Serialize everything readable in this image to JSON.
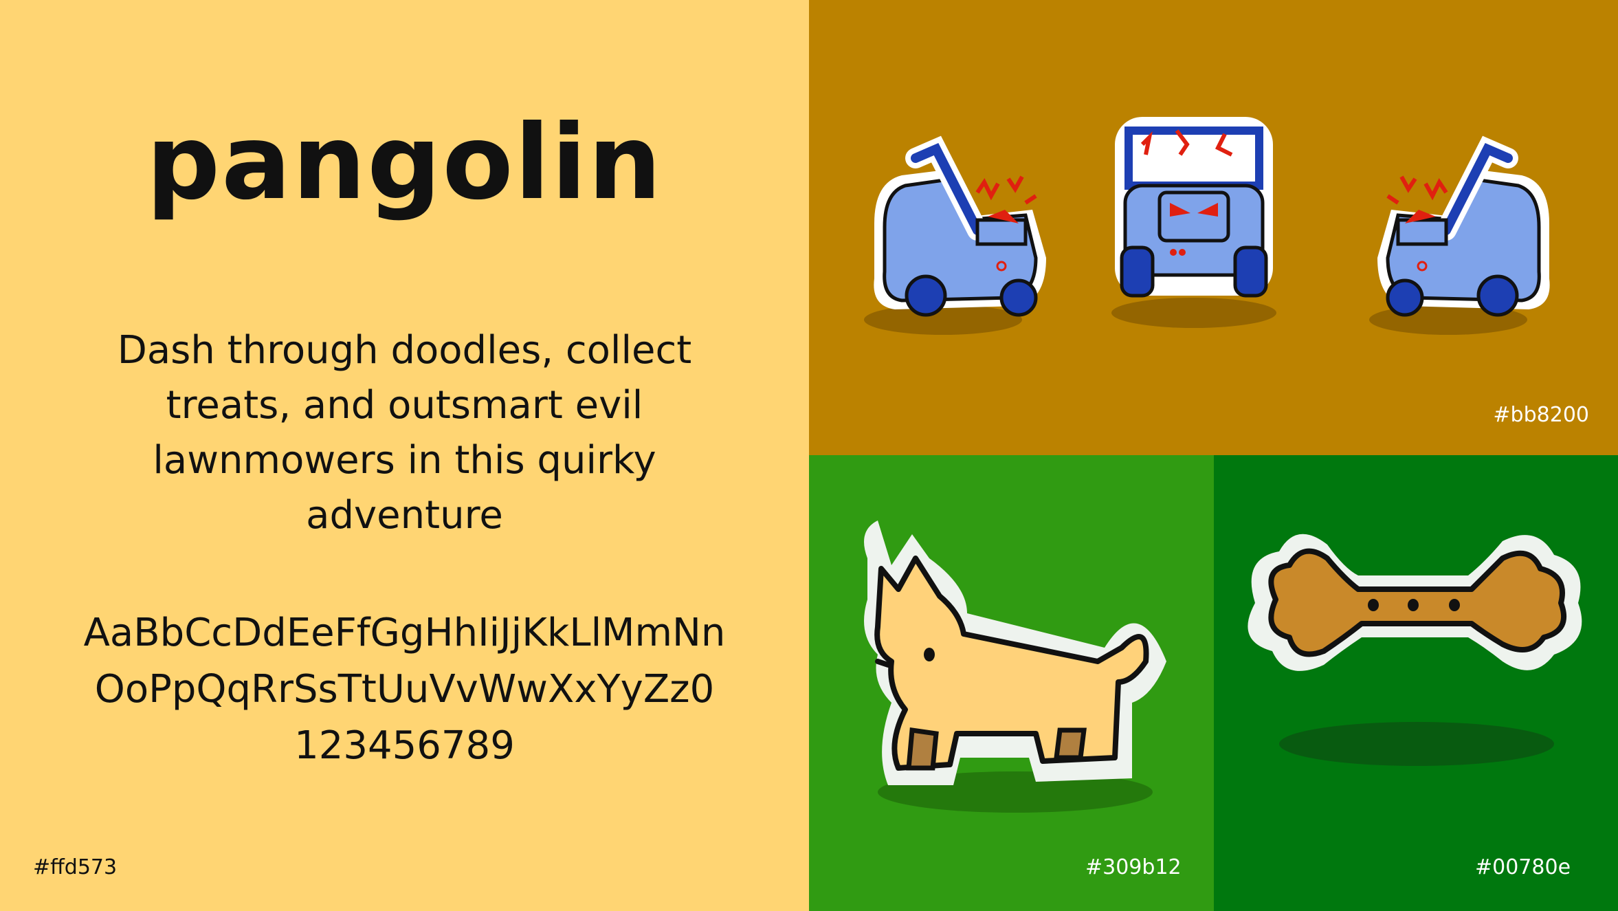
{
  "title": "pangolin",
  "tagline": "Dash through doodles, collect treats, and outsmart evil lawnmowers in this quirky adventure",
  "alphabet": "AaBbCcDdEeFfGgHhIiJjKkLlMmNnOoPpQqRrSsTtUuVvWwXxYyZz0123456789",
  "swatches": {
    "left": "#ffd573",
    "top_right": "#bb8200",
    "bottom_mid": "#309b12",
    "bottom_right": "#00780e"
  },
  "illustrations": {
    "top_right": [
      "lawnmower-icon",
      "lawnmower-icon",
      "lawnmower-icon"
    ],
    "bottom_mid": "dog-icon",
    "bottom_right": "bone-icon"
  }
}
